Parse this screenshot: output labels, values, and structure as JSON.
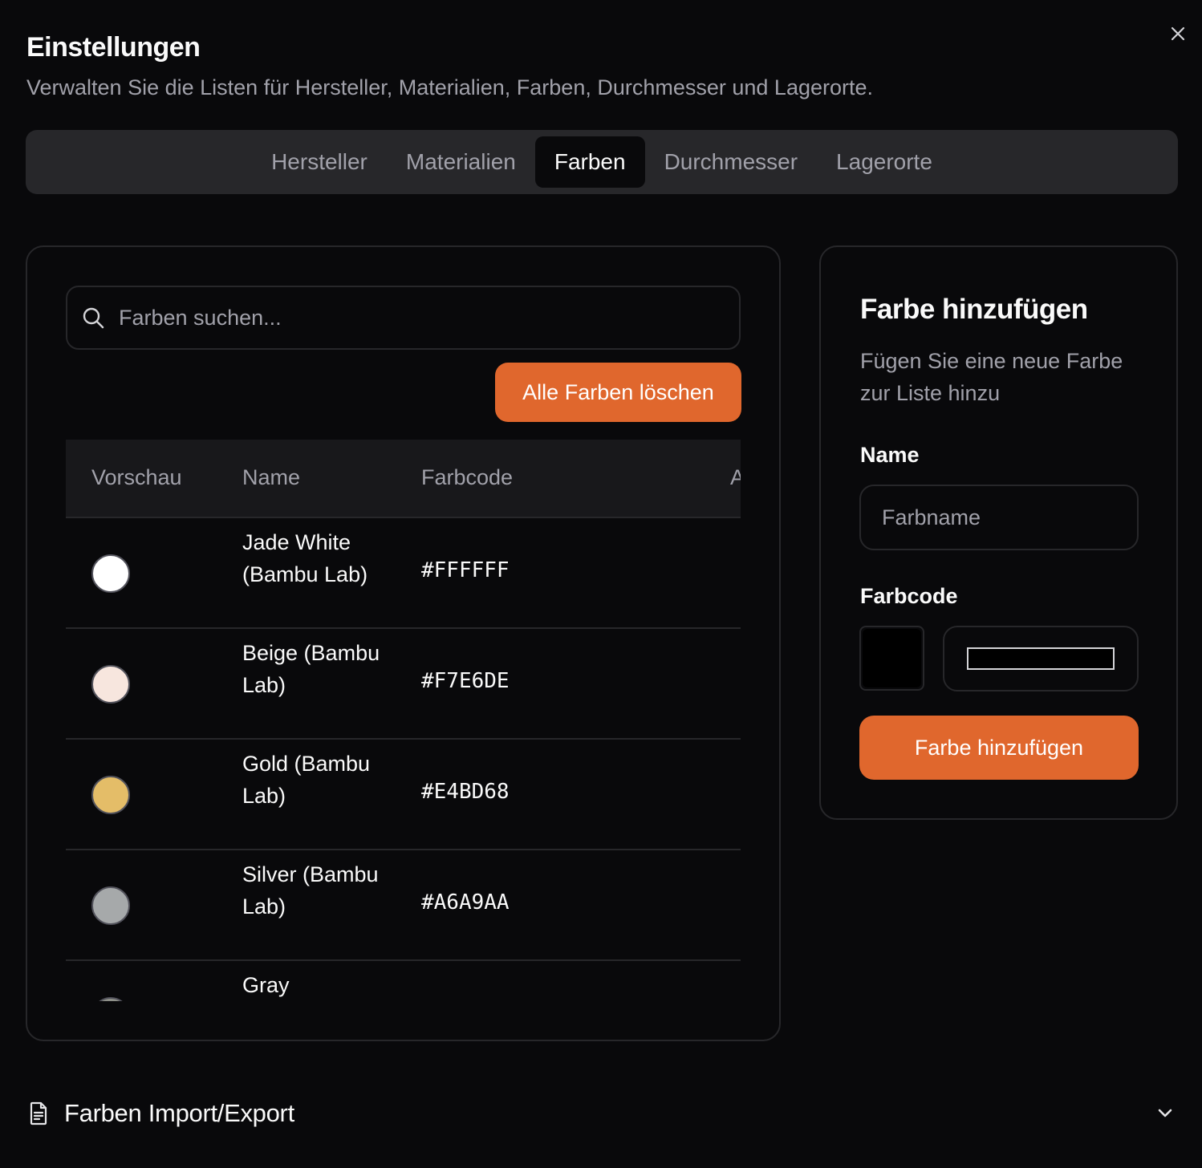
{
  "dialog": {
    "title": "Einstellungen",
    "subtitle": "Verwalten Sie die Listen für Hersteller, Materialien, Farben, Durchmesser und Lagerorte."
  },
  "tabs": [
    {
      "label": "Hersteller",
      "active": false
    },
    {
      "label": "Materialien",
      "active": false
    },
    {
      "label": "Farben",
      "active": true
    },
    {
      "label": "Durchmesser",
      "active": false
    },
    {
      "label": "Lagerorte",
      "active": false
    }
  ],
  "colors_list": {
    "search_placeholder": "Farben suchen...",
    "clear_all_label": "Alle Farben löschen",
    "columns": [
      "Vorschau",
      "Name",
      "Farbcode",
      "A"
    ],
    "rows": [
      {
        "name": "Jade White (Bambu Lab)",
        "code": "#FFFFFF",
        "swatch": "#FFFFFF"
      },
      {
        "name": "Beige (Bambu Lab)",
        "code": "#F7E6DE",
        "swatch": "#F7E6DE"
      },
      {
        "name": "Gold (Bambu Lab)",
        "code": "#E4BD68",
        "swatch": "#E4BD68"
      },
      {
        "name": "Silver (Bambu Lab)",
        "code": "#A6A9AA",
        "swatch": "#A6A9AA"
      },
      {
        "name": "Gray",
        "code": "",
        "swatch": "#8E9089"
      }
    ]
  },
  "add_color": {
    "title": "Farbe hinzufügen",
    "description": "Fügen Sie eine neue Farbe zur Liste hinzu",
    "name_label": "Name",
    "name_placeholder": "Farbname",
    "code_label": "Farbcode",
    "code_value": "#000000",
    "submit_label": "Farbe hinzufügen"
  },
  "footer": {
    "label": "Farben Import/Export"
  },
  "colors": {
    "accent": "#E0672D",
    "background": "#09090B",
    "border": "#27272A"
  },
  "icons": [
    "close-icon",
    "search-icon",
    "document-icon",
    "chevron-down-icon"
  ]
}
